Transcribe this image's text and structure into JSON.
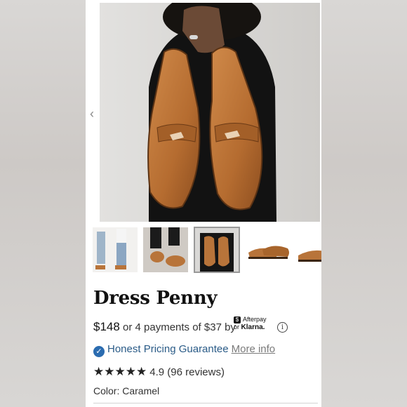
{
  "product": {
    "title": "Dress Penny",
    "price": "$148",
    "installments": "or 4 payments of $37 by",
    "afterpay_label": "Afterpay",
    "klarna_prefix": "or",
    "klarna_label": "Klarna.",
    "guarantee_label": "Honest Pricing Guarantee",
    "more_info_label": "More info",
    "rating_value": "4.9",
    "rating_count": "(96 reviews)",
    "rating_stars": 5,
    "color_label": "Color: Caramel"
  },
  "gallery": {
    "thumbnail_count": 5,
    "selected_index": 2
  },
  "colors": {
    "brand_blue": "#2b6cb0",
    "guarantee_text": "#2a5b87",
    "leather_caramel": "#b8743a"
  },
  "icons": {
    "prev": "chevron-left-icon",
    "guarantee": "check-circle-icon",
    "info": "info-icon",
    "star": "star-icon"
  }
}
